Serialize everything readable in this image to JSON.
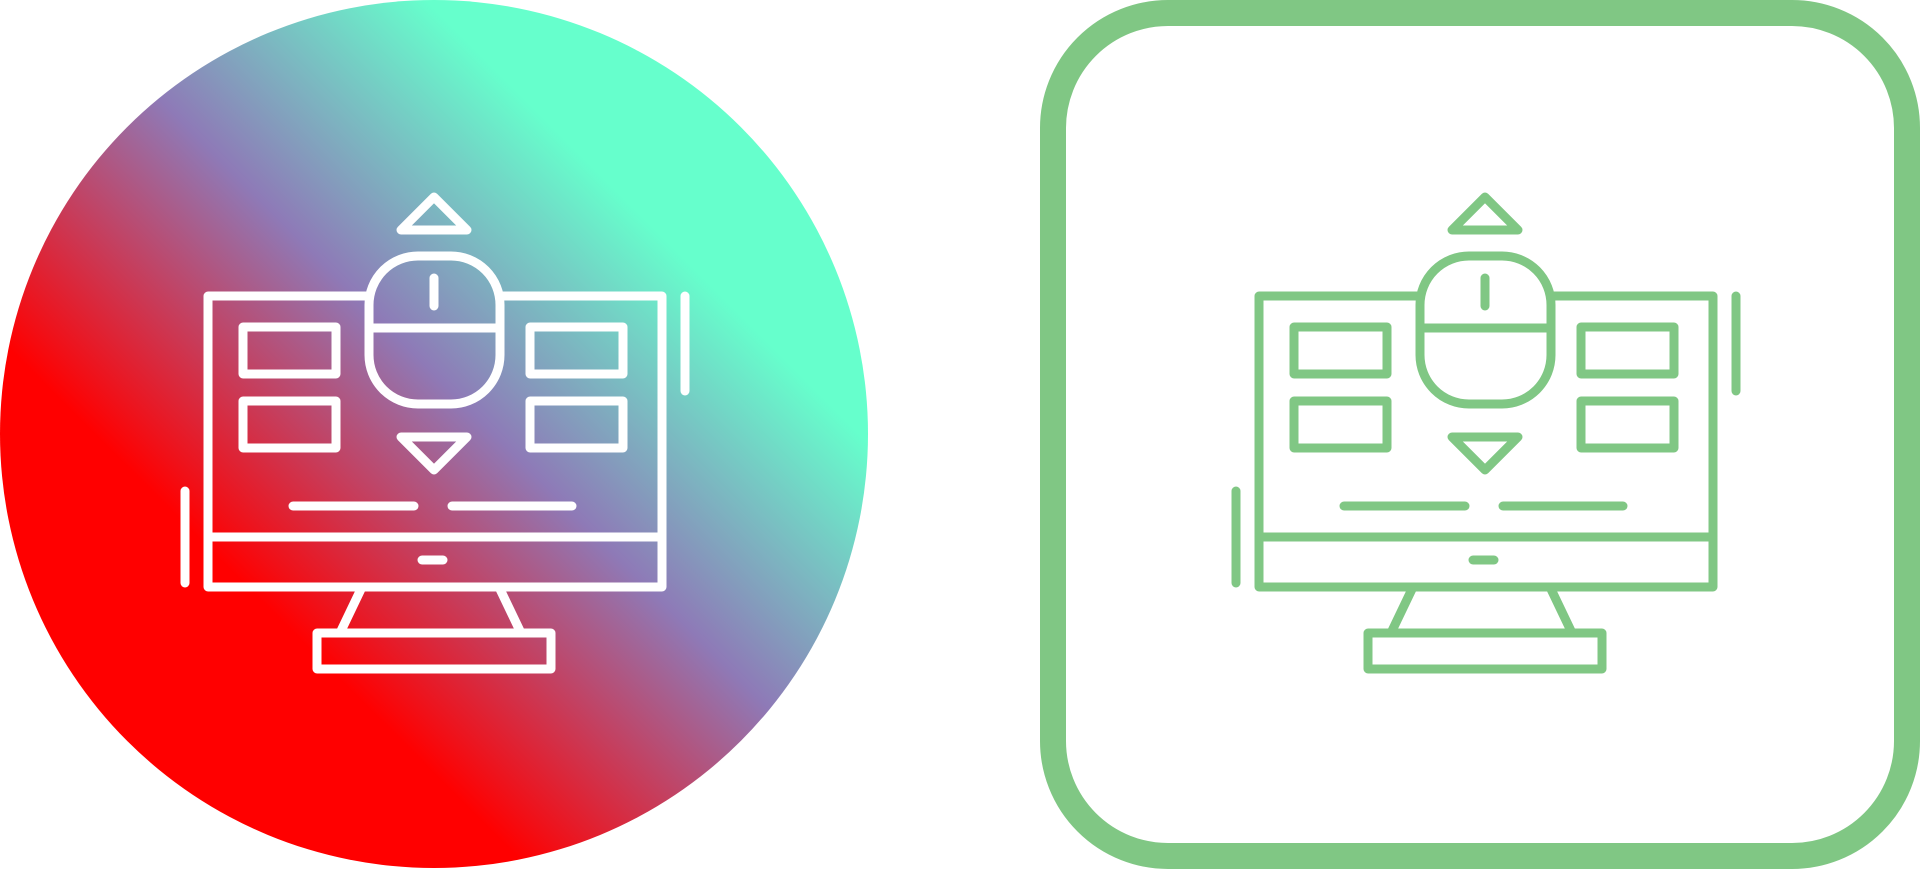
{
  "variants": [
    {
      "style": "gradient-circle",
      "background": "circle",
      "gradient_colors": [
        "#ff0000",
        "#8e7ab7",
        "#66ffcc"
      ],
      "line_color": "#ffffff",
      "icon": "computer-mouse-scroll-icon"
    },
    {
      "style": "outlined-rounded-square",
      "background": "rounded-square-outline",
      "frame_color": "#80c784",
      "line_color": "#80c784",
      "icon": "computer-mouse-scroll-icon"
    }
  ]
}
